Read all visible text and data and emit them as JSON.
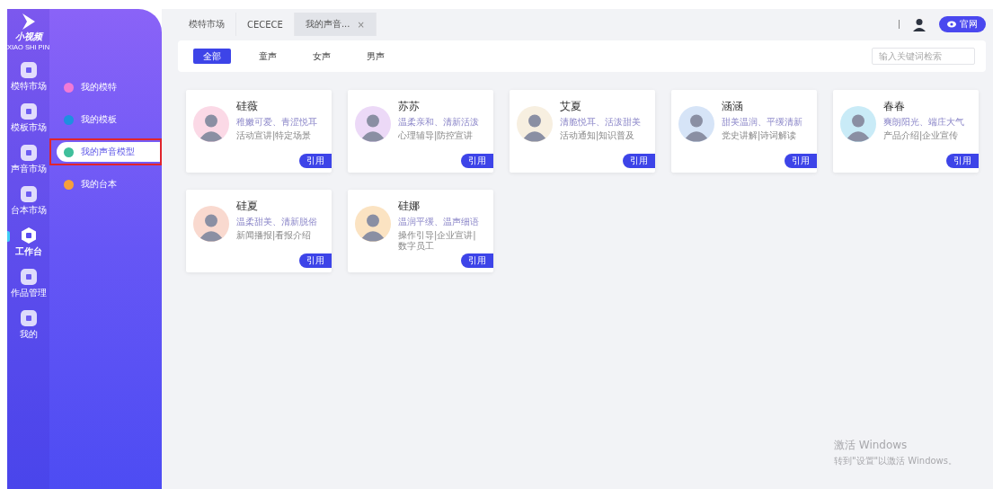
{
  "logo": {
    "name": "小视频",
    "subtitle": "XIAO SHI PIN"
  },
  "rail": [
    {
      "label": "模特市场",
      "selected": false
    },
    {
      "label": "模板市场",
      "selected": false
    },
    {
      "label": "声音市场",
      "selected": false
    },
    {
      "label": "台本市场",
      "selected": false
    },
    {
      "label": "工作台",
      "selected": true
    },
    {
      "label": "作品管理",
      "selected": false
    },
    {
      "label": "我的",
      "selected": false
    }
  ],
  "submenu": [
    {
      "label": "我的模特",
      "selected": false,
      "color": "#f27ad6",
      "highlighted": false
    },
    {
      "label": "我的模板",
      "selected": false,
      "color": "#1e8fe0",
      "highlighted": false
    },
    {
      "label": "我的声音模型",
      "selected": true,
      "color": "#3fbf9b",
      "highlighted": true
    },
    {
      "label": "我的台本",
      "selected": false,
      "color": "#f5a03c",
      "highlighted": false
    }
  ],
  "tabs": [
    {
      "label": "模特市场",
      "selected": false,
      "closable": false
    },
    {
      "label": "CECECE",
      "selected": false,
      "closable": false
    },
    {
      "label": "我的声音...",
      "selected": true,
      "closable": true,
      "close": "×"
    }
  ],
  "header": {
    "site_button": "官网"
  },
  "filters": [
    {
      "label": "全部",
      "selected": true
    },
    {
      "label": "童声",
      "selected": false
    },
    {
      "label": "女声",
      "selected": false
    },
    {
      "label": "男声",
      "selected": false
    }
  ],
  "search": {
    "placeholder": "输入关键词检索"
  },
  "voices": [
    {
      "name": "硅薇",
      "traits": "稚嫩可爱、青涩悦耳",
      "tags": "活动宣讲|特定场景",
      "button": "引用",
      "color": "#fbd9e6"
    },
    {
      "name": "苏苏",
      "traits": "温柔亲和、清新活泼",
      "tags": "心理辅导|防控宣讲",
      "button": "引用",
      "color": "#ecd9f7"
    },
    {
      "name": "艾夏",
      "traits": "清脆悦耳、活泼甜美",
      "tags": "活动通知|知识普及",
      "button": "引用",
      "color": "#f7efe0"
    },
    {
      "name": "涵涵",
      "traits": "甜美温润、平缓清新",
      "tags": "党史讲解|诗词解读",
      "button": "引用",
      "color": "#d6e4f7"
    },
    {
      "name": "春春",
      "traits": "爽朗阳光、端庄大气",
      "tags": "产品介绍|企业宣传",
      "button": "引用",
      "color": "#c9ebf7"
    },
    {
      "name": "硅夏",
      "traits": "温柔甜美、清新脱俗",
      "tags": "新闻播报|看报介绍",
      "button": "引用",
      "color": "#f9d9cf"
    },
    {
      "name": "硅娜",
      "traits": "温润平缓、温声细语",
      "tags": "操作引导|企业宣讲|数字员工",
      "button": "引用",
      "color": "#fbe3c2"
    }
  ],
  "activation": {
    "title": "激活 Windows",
    "hint": "转到\"设置\"以激活 Windows。"
  }
}
